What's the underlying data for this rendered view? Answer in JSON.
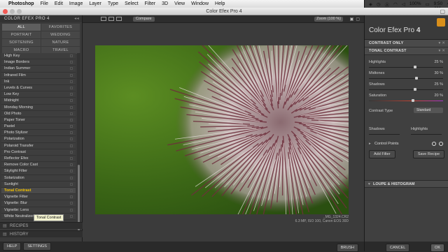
{
  "menubar": {
    "items": [
      "Photoshop",
      "File",
      "Edit",
      "Image",
      "Layer",
      "Type",
      "Select",
      "Filter",
      "3D",
      "View",
      "Window",
      "Help"
    ],
    "battery": "100%",
    "day_time": "Mon 9:50 AM"
  },
  "window": {
    "title": "Color Efex Pro 4"
  },
  "left": {
    "header": "COLOR EFEX PRO 4",
    "categories": [
      "ALL",
      "FAVORITES",
      "PORTRAIT",
      "WEDDING",
      "SOFTENING",
      "NATURE",
      "MACRO",
      "TRAVEL"
    ],
    "filters": [
      "High Key",
      "Image Borders",
      "Indian Summer",
      "Infrared Film",
      "Ink",
      "Levels & Curves",
      "Low Key",
      "Midnight",
      "Monday Morning",
      "Old Photo",
      "Paper Toner",
      "Pastel",
      "Photo Stylizer",
      "Polarization",
      "Polaroid Transfer",
      "Pro Contrast",
      "Reflector Efex",
      "Remove Color Cast",
      "Skylight Filter",
      "Solarization",
      "Sunlight",
      "Tonal Contrast",
      "Vignette Filter",
      "Vignette: Blur",
      "Vignette: Lens",
      "White Neutralizer"
    ],
    "selected_filter": "Tonal Contrast",
    "tooltip": "Tonal Contrast",
    "recipes": "RECIPES",
    "history": "HISTORY",
    "help_btn": "HELP",
    "settings_btn": "SETTINGS"
  },
  "center": {
    "compare": "Compare",
    "zoom": "Zoom (100 %)",
    "image_name": "_MG_1324.CR2",
    "image_meta": "6.3 MP, ISO 100, Canon EOS 30D",
    "brush_btn": "BRUSH"
  },
  "right": {
    "title": "Color Efex Pro",
    "version": "4",
    "rows": [
      {
        "label": "CONTRAST ONLY"
      },
      {
        "label": "TONAL CONTRAST"
      }
    ],
    "sliders": [
      {
        "label": "Highlights",
        "value": "25 %",
        "fraction": 0.6
      },
      {
        "label": "Midtones",
        "value": "30 %",
        "fraction": 0.62
      },
      {
        "label": "Shadows",
        "value": "25 %",
        "fraction": 0.6
      },
      {
        "label": "Saturation",
        "value": "20 %",
        "fraction": 0.58
      }
    ],
    "contrast_type_label": "Contrast Type",
    "contrast_type_value": "Standard",
    "shadows_label": "Shadows",
    "highlights_label": "Highlights",
    "control_points": "Control Points",
    "add_filter": "Add Filter",
    "save_recipe": "Save Recipe",
    "loupe": "LOUPE & HISTOGRAM",
    "cancel_btn": "CANCEL",
    "ok_btn": "OK"
  }
}
